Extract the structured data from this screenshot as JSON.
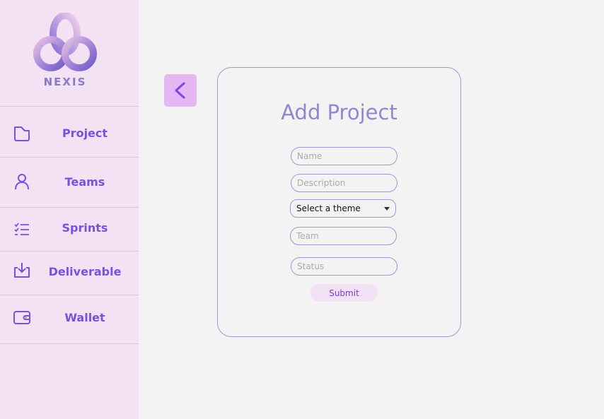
{
  "app": {
    "logo_text": "NEXIS",
    "accent": "#7b4fe0",
    "sidebar_bg": "#f3e2f4"
  },
  "sidebar": {
    "items": [
      {
        "label": "Project",
        "icon": "folder-icon"
      },
      {
        "label": "Teams",
        "icon": "person-icon"
      },
      {
        "label": "Sprints",
        "icon": "checklist-icon"
      },
      {
        "label": "Deliverable",
        "icon": "download-tray-icon"
      },
      {
        "label": "Wallet",
        "icon": "wallet-icon"
      }
    ]
  },
  "back_button": {
    "icon": "chevron-left-icon"
  },
  "form": {
    "title": "Add Project",
    "name_placeholder": "Name",
    "description_placeholder": "Description",
    "theme_select": {
      "selected": "Select a theme"
    },
    "team_placeholder": "Team",
    "status_placeholder": "Status",
    "submit_label": "Submit"
  }
}
